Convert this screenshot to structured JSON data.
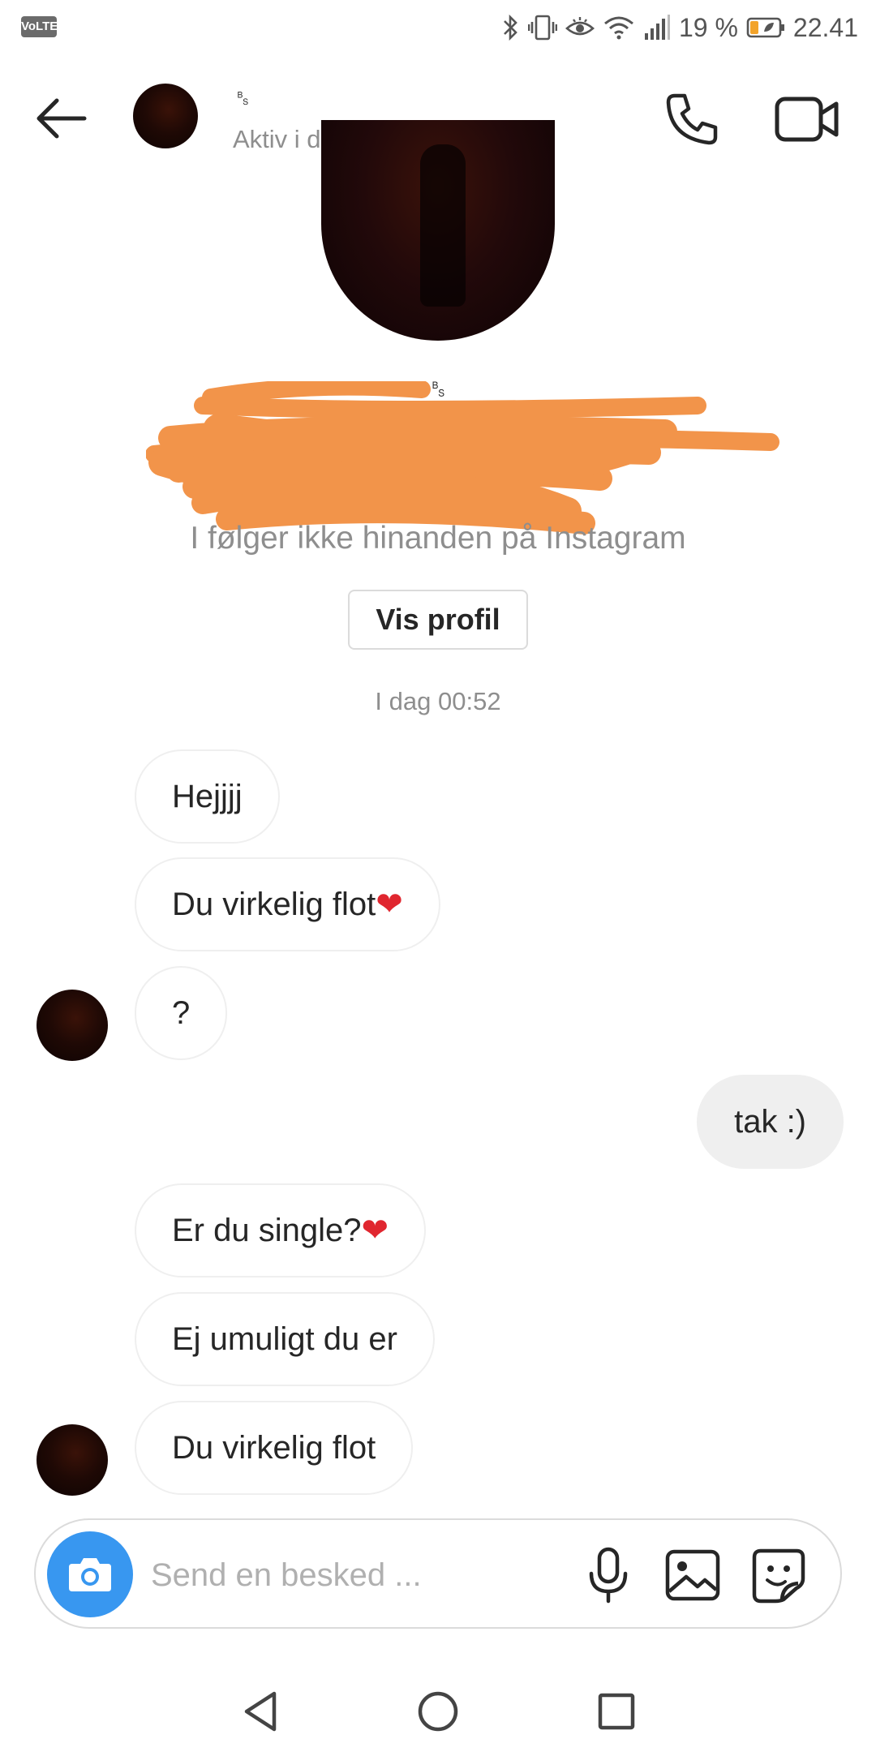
{
  "status_bar": {
    "volte": "VoLTE",
    "battery_percent": "19 %",
    "time": "22.41"
  },
  "header": {
    "name": "␈",
    "status": "Aktiv i dag",
    "icons": [
      "back-arrow-icon",
      "phone-icon",
      "video-camera-icon"
    ]
  },
  "profile": {
    "name": "␈",
    "follow_note": "I følger ikke hinanden på Instagram",
    "view_profile_label": "Vis profil",
    "redaction_color": "#f2944a"
  },
  "conversation": {
    "timestamp": "I dag 00:52",
    "messages": [
      {
        "text": "Hejjjj",
        "heart": ""
      },
      {
        "text": "Du virkelig flot",
        "heart": "❤"
      },
      {
        "text": "?",
        "heart": ""
      },
      {
        "text": "tak :)",
        "heart": ""
      },
      {
        "text": "Er du single?",
        "heart": "❤"
      },
      {
        "text": "Ej umuligt du er",
        "heart": ""
      },
      {
        "text": "Du virkelig flot",
        "heart": ""
      }
    ]
  },
  "composer": {
    "placeholder": "Send en besked ...",
    "accent_color": "#3897f0",
    "icons": [
      "camera-icon",
      "microphone-icon",
      "gallery-icon",
      "sticker-icon"
    ]
  },
  "nav_bar": {
    "icons": [
      "nav-back-icon",
      "nav-home-icon",
      "nav-recents-icon"
    ]
  }
}
